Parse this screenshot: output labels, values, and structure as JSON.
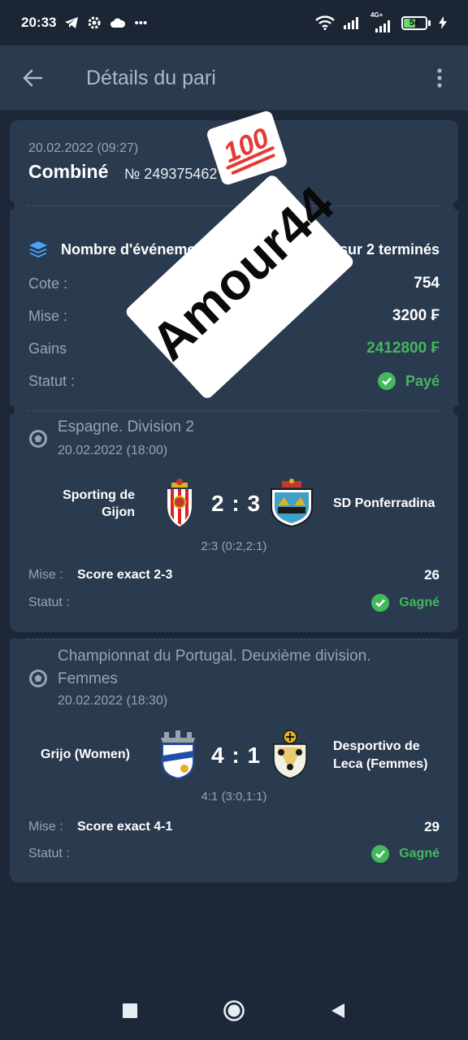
{
  "status_bar": {
    "time": "20:33",
    "network_label": "4G+",
    "battery": "54",
    "battery_level": 0.54,
    "left_icons": [
      "telegram-icon",
      "settings-icon",
      "cloud-icon",
      "more-dots-icon"
    ],
    "right_icons": [
      "wifi-icon",
      "signal-icon",
      "signal-icon",
      "battery-icon",
      "charging-icon"
    ]
  },
  "app_bar": {
    "title": "Détails du pari",
    "back_icon": "arrow-left-icon",
    "menu_icon": "more-vertical-icon"
  },
  "bet": {
    "date": "20.02.2022 (09:27)",
    "type": "Combiné",
    "number": "№ 249375462"
  },
  "summary": {
    "events_label": "Nombre d'événements",
    "events_value": "sur 2 terminés",
    "odds_label": "Cote :",
    "odds_value": "754",
    "stake_label": "Mise :",
    "stake_value": "3200 ₣",
    "win_label": "Gains",
    "win_value": "2412800 ₣",
    "status_label": "Statut :",
    "status_value": "Payé"
  },
  "events": [
    {
      "league": "Espagne. Division 2",
      "date": "20.02.2022 (18:00)",
      "home": "Sporting de Gijon",
      "away": "SD Ponferradina",
      "score": "2 : 3",
      "detail": "2:3 (0:2,2:1)",
      "stake_label": "Mise :",
      "pick": "Score exact 2-3",
      "odd": "26",
      "status_label": "Statut :",
      "status_value": "Gagné"
    },
    {
      "league_line1": "Championnat du Portugal. Deuxième division.",
      "league_line2": "Femmes",
      "date": "20.02.2022 (18:30)",
      "home": "Grijo (Women)",
      "away_line1": "Desportivo de",
      "away_line2": "Leca (Femmes)",
      "score": "4 : 1",
      "detail": "4:1 (3:0,1:1)",
      "stake_label": "Mise :",
      "pick": "Score exact 4-1",
      "odd": "29",
      "status_label": "Statut :",
      "status_value": "Gagné"
    }
  ],
  "watermark": {
    "text": "Amour44",
    "emoji": "💯"
  },
  "nav_bar": {
    "icons": [
      "recents-square-icon",
      "home-circle-icon",
      "back-triangle-icon"
    ]
  },
  "colors": {
    "background": "#1c2838",
    "card": "#2a3a4f",
    "green": "#43b85c",
    "muted": "#98a4b3"
  }
}
